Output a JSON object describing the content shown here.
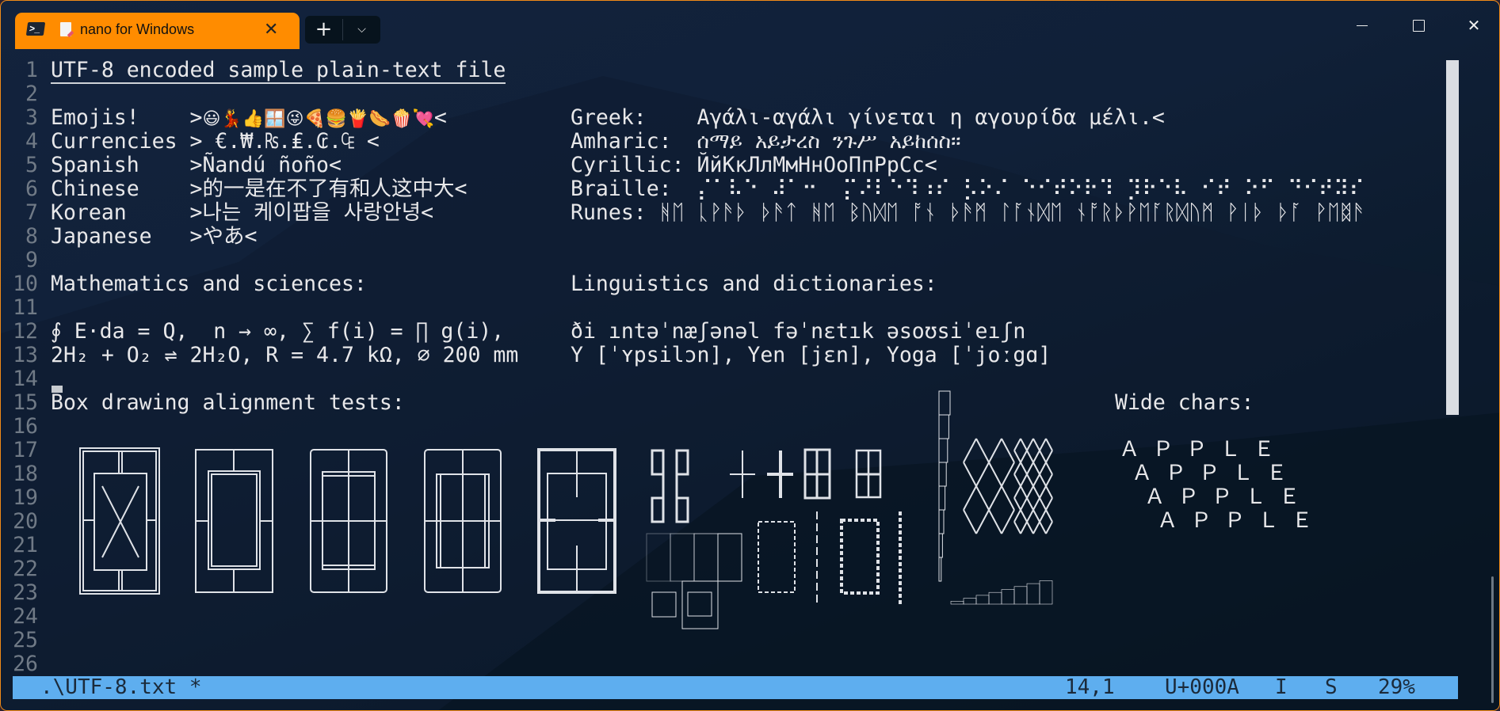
{
  "tab": {
    "title": "nano for Windows",
    "close_glyph": "✕",
    "new_tab_glyph": "+",
    "dropdown_glyph": "⌵"
  },
  "window_controls": {
    "close_glyph": "✕"
  },
  "editor": {
    "line_numbers": [
      "1",
      "2",
      "3",
      "4",
      "5",
      "6",
      "7",
      "8",
      "9",
      "10",
      "11",
      "12",
      "13",
      "14",
      "15",
      "16",
      "17",
      "18",
      "19",
      "20",
      "21",
      "22",
      "23",
      "24",
      "25",
      "26"
    ],
    "lines": {
      "l1": "UTF-8 encoded sample plain-text file",
      "l3a_label": "Emojis!    >",
      "l3a_emojis": "😃💃👍🪟😜🍕🍔🍟🌭🍿💘",
      "l3a_end": "<",
      "l3b": "Greek:    Αγάλι-αγάλι γίνεται η αγουρίδα μέλι.<",
      "l4a": "Currencies > €.₩.₨.₤.₢.₠ <",
      "l4b": "Amharic:  ሰማይ አይታረስ ንጉሥ አይከሰስ።",
      "l5a": "Spanish    >Ñandú ñoño<",
      "l5b": "Cyrillic: ЙйКкЛлМмНнОоПпРрСс<",
      "l6a": "Chinese    >的一是在不了有和人这中大<",
      "l6b": "Braille:  ⡌⠁⠧⠑ ⠼⠁⠒  ⡍⠜⠇⠑⠹⠰⠎ ⡣⠕⠌ ⠑⠊⠞⠕⠗⠹ ⡹⠗⠑⠧ ⠊⠞ ⠕⠋ ⠙⠊⠞⠽⠎",
      "l7a": "Korean     >나는 케이팝을 사랑안녕<",
      "l7b": "Runes: ᚻᛖ ᚳᚹᚫᚦ ᚦᚫᛏ ᚻᛖ ᛒᚢᛞᛖ ᚩᚾ ᚦᚫᛗ ᛚᚪᚾᛞᛖ ᚾᚩᚱᚦᚹᛖᚪᚱᛞᚢᛗ ᚹᛁᚦ ᚦᚪ ᚹᛖᛥᚫ",
      "l8a": "Japanese   >やあ<",
      "l10a": "Mathematics and sciences:",
      "l10b": "Linguistics and dictionaries:",
      "l12a": "∮ E⋅da = Q,  n → ∞, ∑ f(i) = ∏ g(i),",
      "l12b": "ði ıntəˈnæʃənəl fəˈnɛtık əsoʊsiˈeıʃn",
      "l13a": "2H₂ + O₂ ⇌ 2H₂O, R = 4.7 kΩ, ⌀ 200 mm",
      "l13b": "Y [ˈʏpsilɔn], Yen [jɛn], Yoga [ˈjoːgɑ]",
      "l15a": "Box drawing alignment tests:",
      "l15b": "Wide chars:",
      "wide": [
        "Ａ Ｐ Ｐ Ｌ Ｅ",
        "Ａ Ｐ Ｐ Ｌ Ｅ",
        "Ａ Ｐ Ｐ Ｌ Ｅ",
        "Ａ Ｐ Ｐ Ｌ Ｅ"
      ]
    }
  },
  "status": {
    "filename": ".\\UTF-8.txt *",
    "position": "14,1",
    "codepoint": "U+000A",
    "mode_i": "I",
    "mode_s": "S",
    "percent": "29%"
  },
  "scrollbar": {
    "position_percent": 29
  },
  "colors": {
    "tab_accent": "#ff8c00",
    "status_bar": "#5eaeef",
    "text": "#e8e8ea",
    "line_number": "#707a86"
  }
}
